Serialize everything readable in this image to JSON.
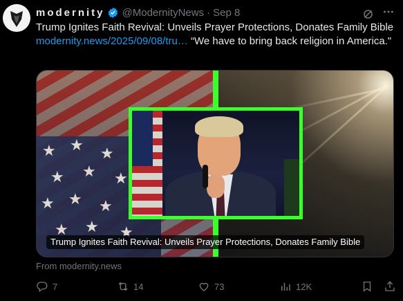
{
  "author": {
    "display_name": "modernity",
    "handle": "@ModernityNews",
    "separator": "·",
    "date": "Sep 8",
    "verified": true
  },
  "tweet": {
    "text_before": "Trump Ignites Faith Revival: Unveils Prayer Protections, Donates Family Bible ",
    "link": "modernity.news/2025/09/08/tru…",
    "text_after": " “We have to bring back religion in America.\""
  },
  "card": {
    "caption": "Trump Ignites Faith Revival: Unveils Prayer Protections, Donates Family Bible",
    "source": "From modernity.news",
    "accent_color": "#3cff2e"
  },
  "actions": {
    "replies": "7",
    "reposts": "14",
    "likes": "73",
    "views": "12K"
  },
  "icons": {
    "reply": "reply-icon",
    "repost": "repost-icon",
    "like": "heart-icon",
    "views": "views-icon",
    "bookmark": "bookmark-icon",
    "share": "share-icon",
    "grok": "grok-icon",
    "more": "more-icon"
  },
  "colors": {
    "background": "#000000",
    "text": "#e7e9ea",
    "muted": "#71767b",
    "link": "#1d9bf0",
    "verified": "#1d9bf0"
  }
}
